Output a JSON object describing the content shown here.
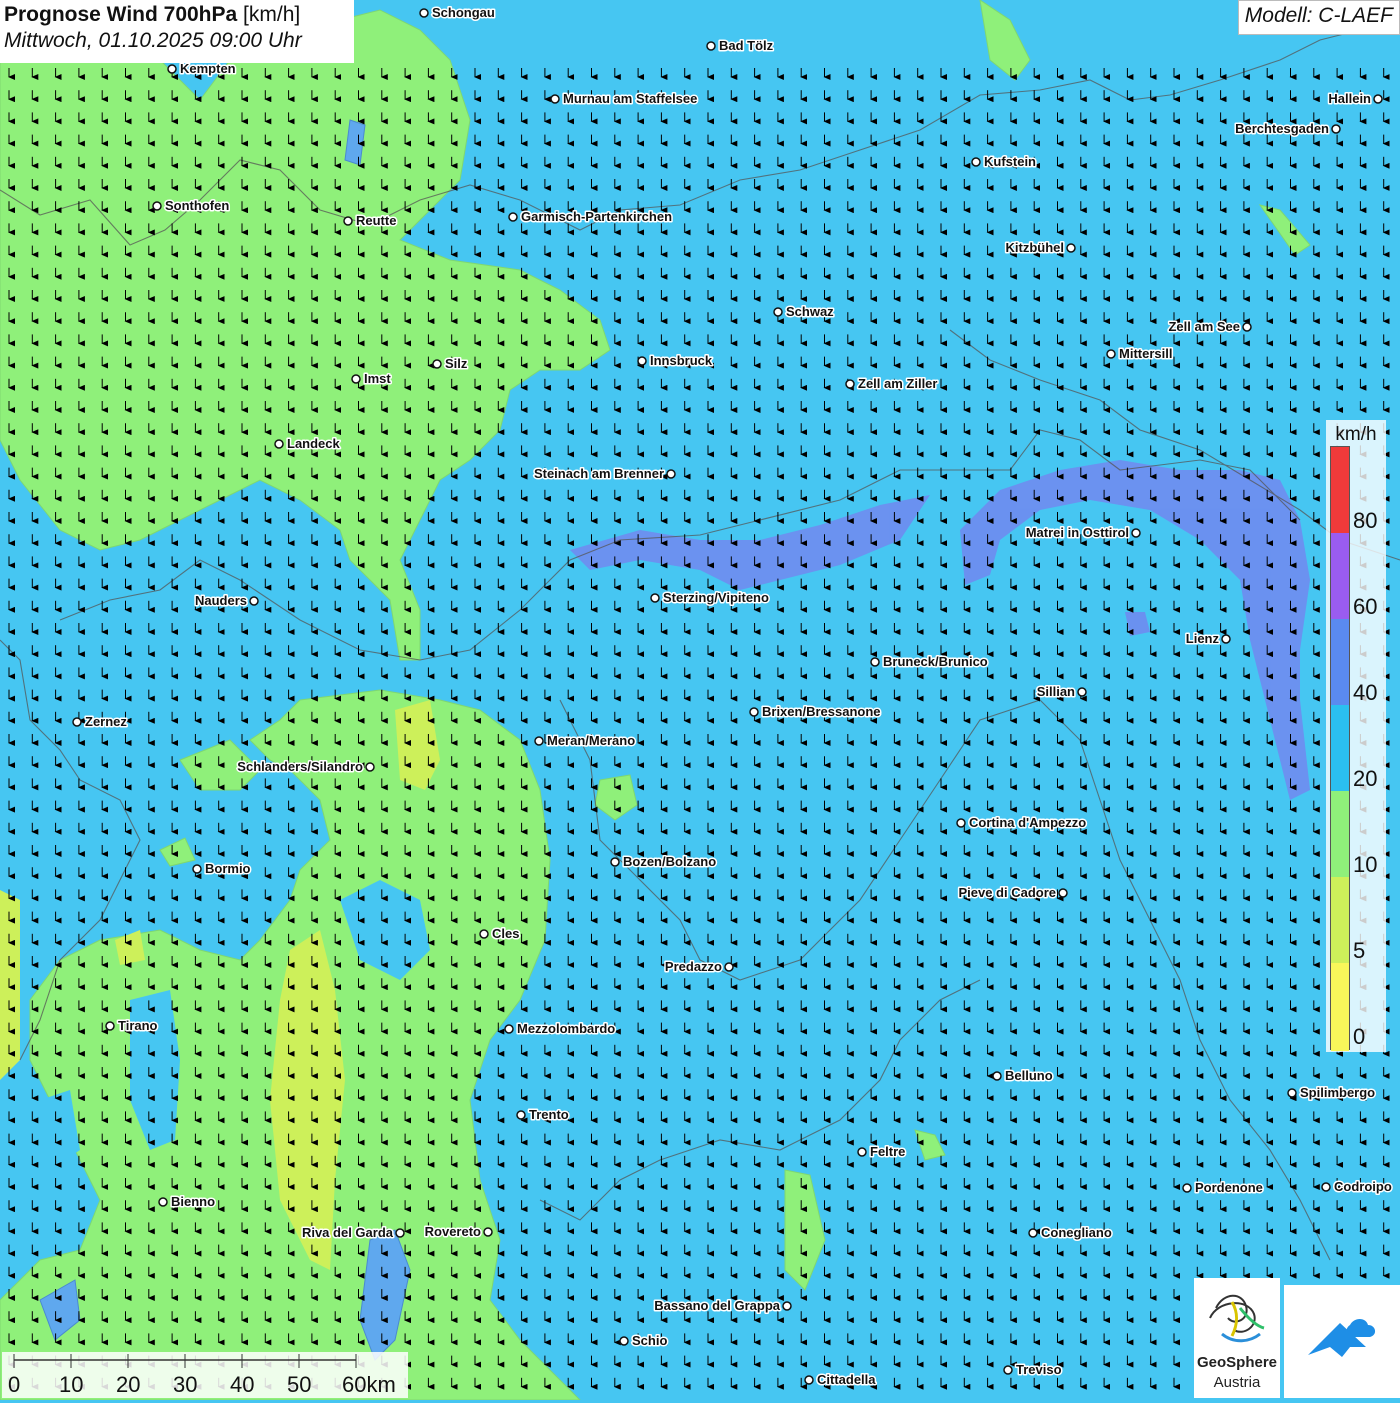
{
  "header": {
    "title": "Prognose Wind 700hPa",
    "unit": "[km/h]",
    "datetime": "Mittwoch, 01.10.2025 09:00 Uhr",
    "model": "Modell: C-LAEF"
  },
  "legend": {
    "unit": "km/h",
    "classes": [
      {
        "from": 0,
        "to": 5,
        "color": "#f8f75a"
      },
      {
        "from": 5,
        "to": 10,
        "color": "#cdf05a"
      },
      {
        "from": 10,
        "to": 20,
        "color": "#8ff07a"
      },
      {
        "from": 20,
        "to": 40,
        "color": "#2bbff0"
      },
      {
        "from": 40,
        "to": 60,
        "color": "#5a8af0"
      },
      {
        "from": 60,
        "to": 80,
        "color": "#9a5cf0"
      },
      {
        "from": 80,
        "to": 100,
        "color": "#f03a3a"
      }
    ],
    "ticks": [
      "0",
      "5",
      "10",
      "20",
      "40",
      "60",
      "80"
    ]
  },
  "scalebar": {
    "labels": [
      "0",
      "10",
      "20",
      "30",
      "40",
      "50",
      "60km"
    ]
  },
  "logos": {
    "geosphere_line1": "GeoSphere",
    "geosphere_line2": "Austria",
    "geosphere_icon": "geosphere-logo-icon",
    "second_icon": "mountain-cloud-logo-icon"
  },
  "wind": {
    "direction": "north (arrows pointing south)",
    "arrow_color": "#000000"
  },
  "colors": {
    "speed_20_40": "#46c6f2",
    "speed_10_20": "#8ff07a",
    "speed_5_10": "#cdf05a",
    "speed_40_60": "#5a8af0",
    "water": "#5fa8ee"
  },
  "cities": [
    {
      "name": "Schongau",
      "anchor": "right"
    },
    {
      "name": "Bad Tölz",
      "anchor": "right"
    },
    {
      "name": "Kempten",
      "anchor": "right"
    },
    {
      "name": "Murnau am Staffelsee",
      "anchor": "right"
    },
    {
      "name": "Hallein",
      "anchor": "left"
    },
    {
      "name": "Berchtesgaden",
      "anchor": "left"
    },
    {
      "name": "Kufstein",
      "anchor": "right"
    },
    {
      "name": "Sonthofen",
      "anchor": "right"
    },
    {
      "name": "Reutte",
      "anchor": "right"
    },
    {
      "name": "Garmisch-Partenkirchen",
      "anchor": "right"
    },
    {
      "name": "Kitzbühel",
      "anchor": "left"
    },
    {
      "name": "Schwaz",
      "anchor": "right"
    },
    {
      "name": "Zell am See",
      "anchor": "left"
    },
    {
      "name": "Innsbruck",
      "anchor": "right"
    },
    {
      "name": "Mittersill",
      "anchor": "right"
    },
    {
      "name": "Silz",
      "anchor": "right"
    },
    {
      "name": "Imst",
      "anchor": "right"
    },
    {
      "name": "Zell am Ziller",
      "anchor": "right"
    },
    {
      "name": "Landeck",
      "anchor": "right"
    },
    {
      "name": "Steinach am Brenner",
      "anchor": "left"
    },
    {
      "name": "Matrei in Osttirol",
      "anchor": "left"
    },
    {
      "name": "Nauders",
      "anchor": "left"
    },
    {
      "name": "Sterzing/Vipiteno",
      "anchor": "right"
    },
    {
      "name": "Lienz",
      "anchor": "left"
    },
    {
      "name": "Bruneck/Brunico",
      "anchor": "right"
    },
    {
      "name": "Sillian",
      "anchor": "left"
    },
    {
      "name": "Brixen/Bressanone",
      "anchor": "right"
    },
    {
      "name": "Zernez",
      "anchor": "right"
    },
    {
      "name": "Meran/Merano",
      "anchor": "right"
    },
    {
      "name": "Schlanders/Silandro",
      "anchor": "left"
    },
    {
      "name": "Cortina d'Ampezzo",
      "anchor": "right"
    },
    {
      "name": "Bozen/Bolzano",
      "anchor": "right"
    },
    {
      "name": "Bormio",
      "anchor": "right"
    },
    {
      "name": "Pieve di Cadore",
      "anchor": "left"
    },
    {
      "name": "Cles",
      "anchor": "right"
    },
    {
      "name": "Predazzo",
      "anchor": "left"
    },
    {
      "name": "Tirano",
      "anchor": "right"
    },
    {
      "name": "Mezzolombardo",
      "anchor": "right"
    },
    {
      "name": "Belluno",
      "anchor": "right"
    },
    {
      "name": "Spilimbergo",
      "anchor": "right"
    },
    {
      "name": "Trento",
      "anchor": "right"
    },
    {
      "name": "Feltre",
      "anchor": "right"
    },
    {
      "name": "Pordenone",
      "anchor": "right"
    },
    {
      "name": "Codroipo",
      "anchor": "right"
    },
    {
      "name": "Bienno",
      "anchor": "right"
    },
    {
      "name": "Riva del Garda",
      "anchor": "left"
    },
    {
      "name": "Rovereto",
      "anchor": "left"
    },
    {
      "name": "Conegliano",
      "anchor": "right"
    },
    {
      "name": "Bassano del Grappa",
      "anchor": "left"
    },
    {
      "name": "Schio",
      "anchor": "right"
    },
    {
      "name": "Treviso",
      "anchor": "right"
    },
    {
      "name": "Cittadella",
      "anchor": "right"
    }
  ]
}
